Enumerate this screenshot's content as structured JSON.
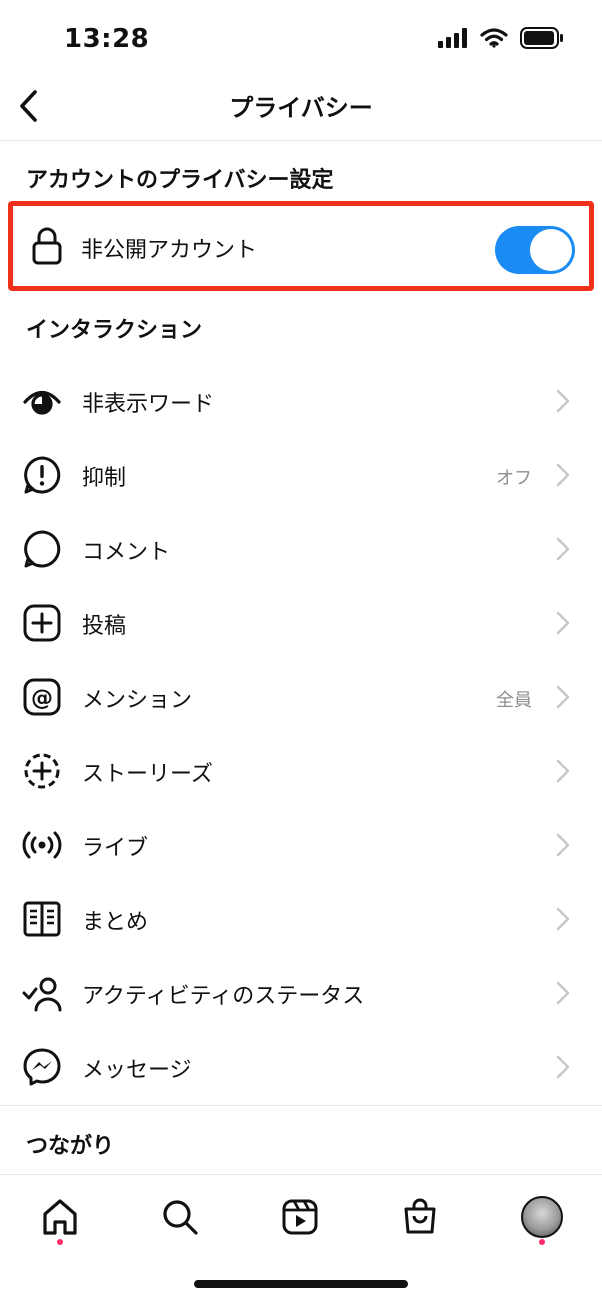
{
  "status_bar": {
    "time": "13:28"
  },
  "header": {
    "title": "プライバシー"
  },
  "account_privacy": {
    "section_title": "アカウントのプライバシー設定",
    "private_account_label": "非公開アカウント",
    "private_account_on": true
  },
  "interactions": {
    "section_title": "インタラクション",
    "items": [
      {
        "label": "非表示ワード",
        "value": "",
        "icon": "eye-icon"
      },
      {
        "label": "抑制",
        "value": "オフ",
        "icon": "exclamation-circle-icon"
      },
      {
        "label": "コメント",
        "value": "",
        "icon": "comment-icon"
      },
      {
        "label": "投稿",
        "value": "",
        "icon": "plus-square-icon"
      },
      {
        "label": "メンション",
        "value": "全員",
        "icon": "at-icon"
      },
      {
        "label": "ストーリーズ",
        "value": "",
        "icon": "story-add-icon"
      },
      {
        "label": "ライブ",
        "value": "",
        "icon": "live-icon"
      },
      {
        "label": "まとめ",
        "value": "",
        "icon": "guide-book-icon"
      },
      {
        "label": "アクティビティのステータス",
        "value": "",
        "icon": "activity-status-icon"
      },
      {
        "label": "メッセージ",
        "value": "",
        "icon": "messenger-icon"
      }
    ]
  },
  "connections": {
    "section_title": "つながり"
  },
  "tab_bar": {
    "tabs": [
      {
        "name": "home",
        "icon": "home-icon",
        "dot": true
      },
      {
        "name": "search",
        "icon": "search-icon",
        "dot": false
      },
      {
        "name": "reels",
        "icon": "reels-icon",
        "dot": false
      },
      {
        "name": "shop",
        "icon": "shop-bag-icon",
        "dot": false
      },
      {
        "name": "profile",
        "icon": "avatar",
        "dot": true
      }
    ]
  },
  "colors": {
    "toggle_on": "#1a8cf3",
    "highlight_border": "#f0301a",
    "notification_dot": "#ff2b6a"
  }
}
